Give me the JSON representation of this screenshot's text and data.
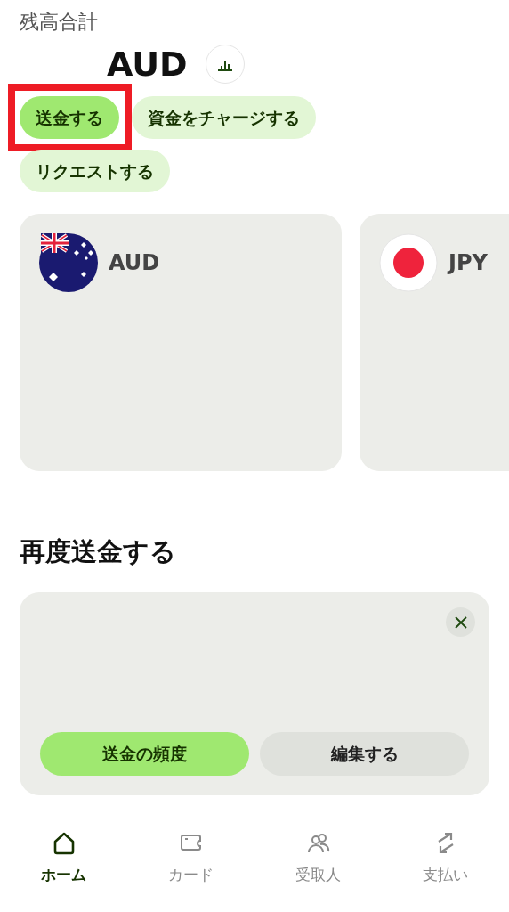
{
  "balance": {
    "label": "残高合計",
    "currency": "AUD"
  },
  "actions": [
    {
      "label": "送金する",
      "kind": "primary",
      "highlighted": true
    },
    {
      "label": "資金をチャージする",
      "kind": "secondary",
      "highlighted": false
    },
    {
      "label": "リクエストする",
      "kind": "secondary",
      "highlighted": false
    }
  ],
  "accounts": [
    {
      "currency": "AUD",
      "kind": "au"
    },
    {
      "currency": "JPY",
      "kind": "jp"
    }
  ],
  "repeat_transfer": {
    "title": "再度送金する",
    "buttons": [
      {
        "label": "送金の頻度",
        "kind": "primary"
      },
      {
        "label": "編集する",
        "kind": "secondary"
      }
    ]
  },
  "nav": [
    {
      "label": "ホーム",
      "kind": "home",
      "selected": true
    },
    {
      "label": "カード",
      "kind": "card",
      "selected": false
    },
    {
      "label": "受取人",
      "kind": "people",
      "selected": false
    },
    {
      "label": "支払い",
      "kind": "swap",
      "selected": false
    }
  ]
}
